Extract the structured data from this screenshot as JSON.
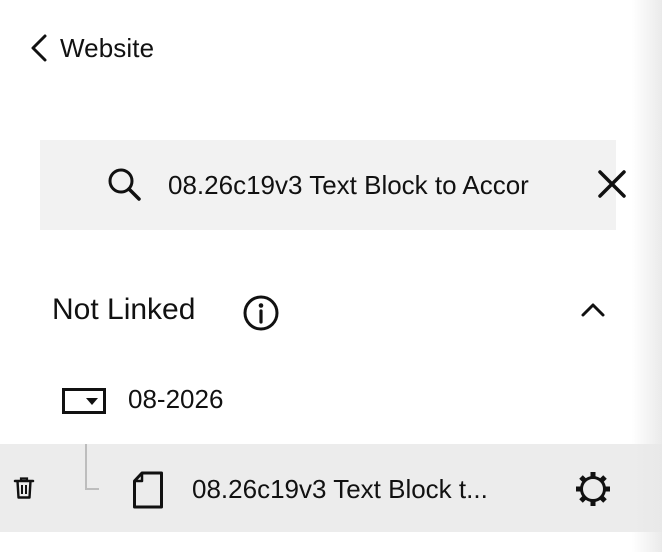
{
  "nav": {
    "back_label": "Website"
  },
  "search": {
    "value": "08.26c19v3 Text Block to Accor"
  },
  "section": {
    "title": "Not Linked"
  },
  "folder": {
    "label": "08-2026"
  },
  "page": {
    "label": "08.26c19v3 Text Block t..."
  },
  "icons": {
    "back": "chevron-left-icon",
    "search": "search-icon",
    "clear": "close-icon",
    "info": "info-icon",
    "collapse": "chevron-up-icon",
    "folder": "folder-dropdown-icon",
    "trash": "trash-icon",
    "page": "page-icon",
    "settings": "gear-icon"
  },
  "colors": {
    "search_bg": "#f2f2f2",
    "selected_row_bg": "#ececec",
    "text": "#111111"
  }
}
